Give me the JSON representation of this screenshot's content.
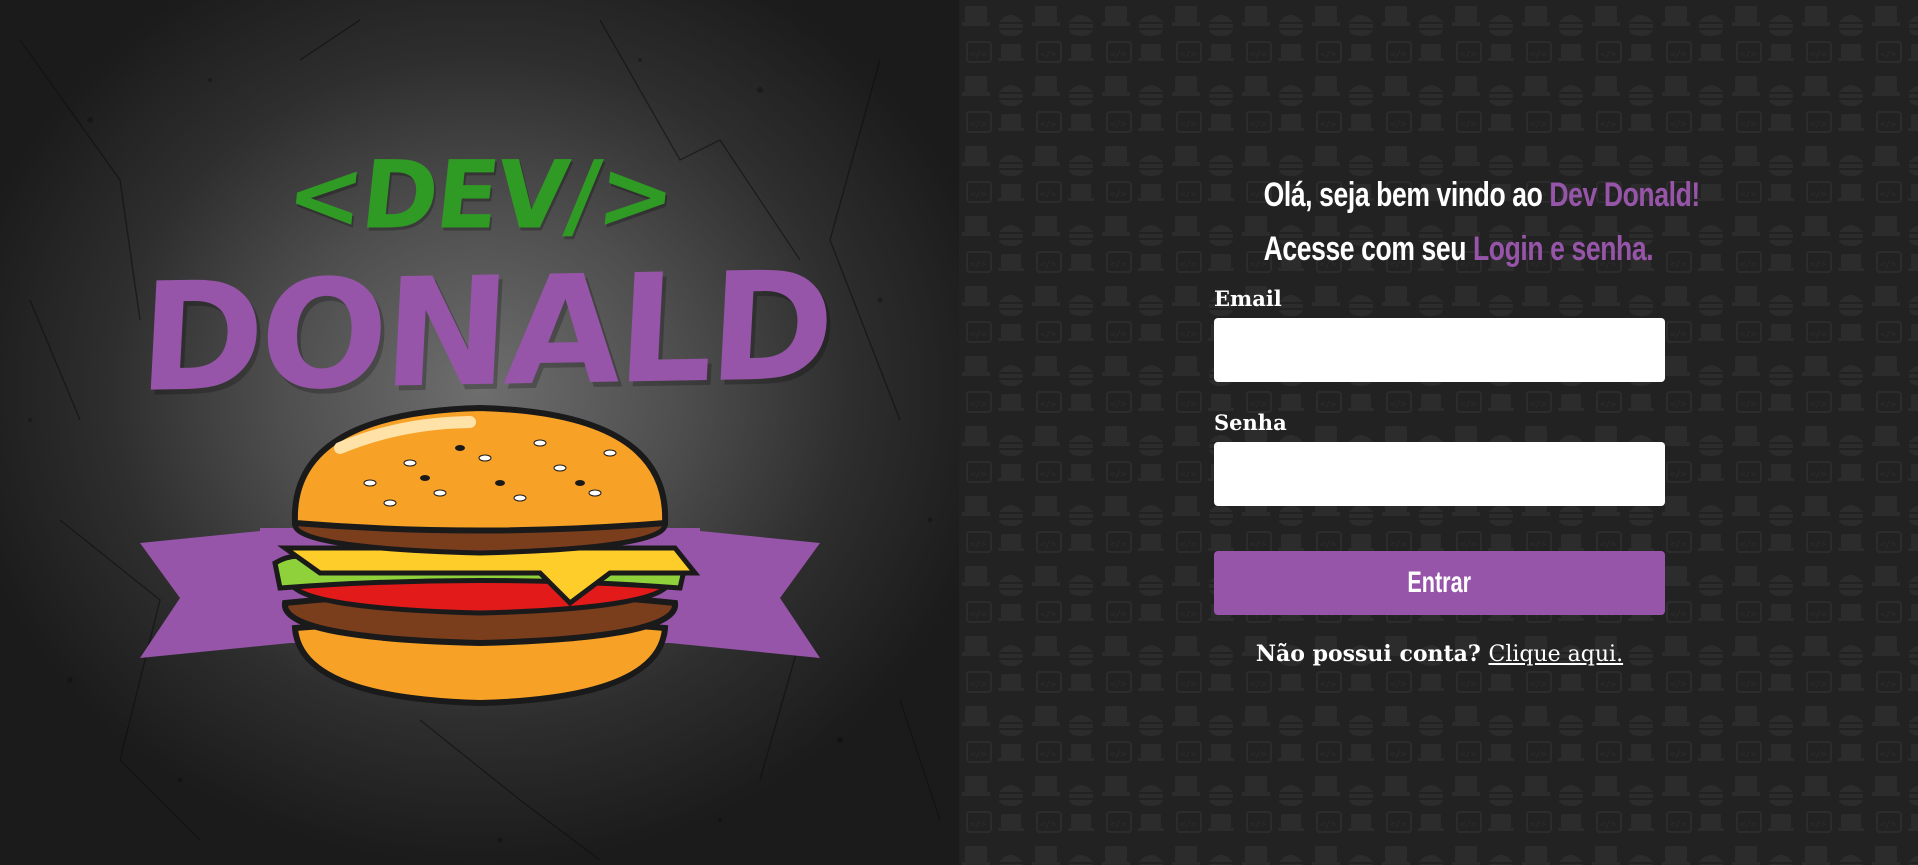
{
  "brand": {
    "logo_dev": "<DEV/>",
    "logo_donald": "DONALD"
  },
  "login": {
    "headline_line1_prefix": "Olá, seja bem vindo ao ",
    "headline_line1_accent": "Dev Donald!",
    "headline_line2_prefix": "Acesse com seu ",
    "headline_line2_accent": "Login e senha.",
    "email_label": "Email",
    "email_value": "",
    "password_label": "Senha",
    "password_value": "",
    "submit_label": "Entrar",
    "signup_prompt": "Não possui conta?",
    "signup_link": "Clique aqui."
  },
  "colors": {
    "accent_purple": "#9655a8",
    "logo_green": "#2f9a24",
    "panel_dark": "#222222",
    "text_white": "#ffffff"
  },
  "icons": {
    "background_pattern": [
      "computer-icon",
      "burger-icon",
      "code-tag-icon"
    ],
    "illustration": "burger-icon"
  }
}
